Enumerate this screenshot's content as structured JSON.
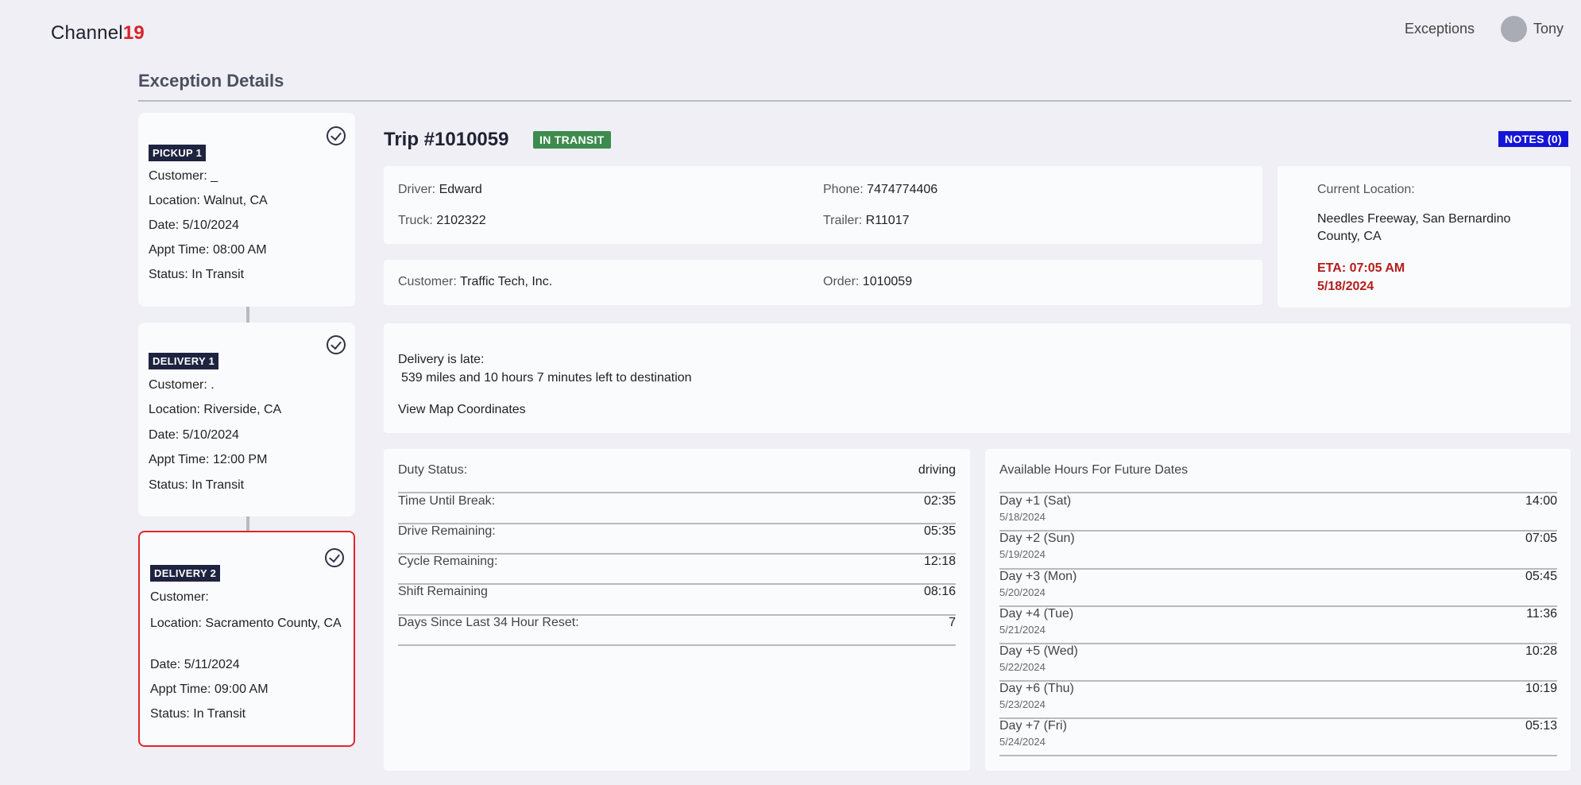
{
  "header": {
    "logo_text": "Channel",
    "logo_accent": "19",
    "nav_exceptions": "Exceptions",
    "user_name": "Tony"
  },
  "page": {
    "title": "Exception Details"
  },
  "stops": [
    {
      "tag": "PICKUP 1",
      "customer_label": "Customer:",
      "customer": "_",
      "location_label": "Location:",
      "location": "Walnut, CA",
      "date_label": "Date:",
      "date": "5/10/2024",
      "appt_label": "Appt Time:",
      "appt": "08:00 AM",
      "status_label": "Status:",
      "status": "In Transit"
    },
    {
      "tag": "DELIVERY 1",
      "customer_label": "Customer:",
      "customer": ".",
      "location_label": "Location:",
      "location": "Riverside, CA",
      "date_label": "Date:",
      "date": "5/10/2024",
      "appt_label": "Appt Time:",
      "appt": "12:00 PM",
      "status_label": "Status:",
      "status": "In Transit"
    },
    {
      "tag": "DELIVERY 2",
      "customer_label": "Customer:",
      "customer": "",
      "location_label": "Location:",
      "location": "Sacramento County, CA",
      "date_label": "Date:",
      "date": "5/11/2024",
      "appt_label": "Appt Time:",
      "appt": "09:00 AM",
      "status_label": "Status:",
      "status": "In Transit"
    }
  ],
  "trip": {
    "title": "Trip #1010059",
    "status": "IN TRANSIT",
    "notes_label": "NOTES (0)",
    "driver_label": "Driver:",
    "driver": "Edward",
    "phone_label": "Phone:",
    "phone": "7474774406",
    "truck_label": "Truck:",
    "truck": "2102322",
    "trailer_label": "Trailer:",
    "trailer": "R11017",
    "customer_label": "Customer:",
    "customer": "Traffic Tech, Inc.",
    "order_label": "Order:",
    "order": "1010059",
    "current_location_label": "Current Location:",
    "current_location_line1": "Needles Freeway, San Bernardino",
    "current_location_line2": "County, CA",
    "eta_line1": "ETA: 07:05 AM",
    "eta_line2": "5/18/2024"
  },
  "alert": {
    "title": "Delivery is late:",
    "detail": "539 miles and 10 hours 7 minutes left to destination",
    "map_link": "View Map Coordinates"
  },
  "hos": {
    "duty_label": "Duty Status:",
    "duty_value": "driving",
    "rows": [
      {
        "label": "Time Until Break:",
        "value": "02:35"
      },
      {
        "label": "Drive Remaining:",
        "value": "05:35"
      },
      {
        "label": "Cycle Remaining:",
        "value": "12:18"
      },
      {
        "label": "Shift Remaining",
        "value": "08:16"
      },
      {
        "label": "Days Since Last 34 Hour Reset:",
        "value": "7"
      }
    ]
  },
  "future": {
    "title": "Available Hours For Future Dates",
    "days": [
      {
        "label": "Day +1 (Sat)",
        "date": "5/18/2024",
        "value": "14:00"
      },
      {
        "label": "Day +2 (Sun)",
        "date": "5/19/2024",
        "value": "07:05"
      },
      {
        "label": "Day +3 (Mon)",
        "date": "5/20/2024",
        "value": "05:45"
      },
      {
        "label": "Day +4 (Tue)",
        "date": "5/21/2024",
        "value": "11:36"
      },
      {
        "label": "Day +5 (Wed)",
        "date": "5/22/2024",
        "value": "10:28"
      },
      {
        "label": "Day +6 (Thu)",
        "date": "5/23/2024",
        "value": "10:19"
      },
      {
        "label": "Day +7 (Fri)",
        "date": "5/24/2024",
        "value": "05:13"
      }
    ]
  }
}
